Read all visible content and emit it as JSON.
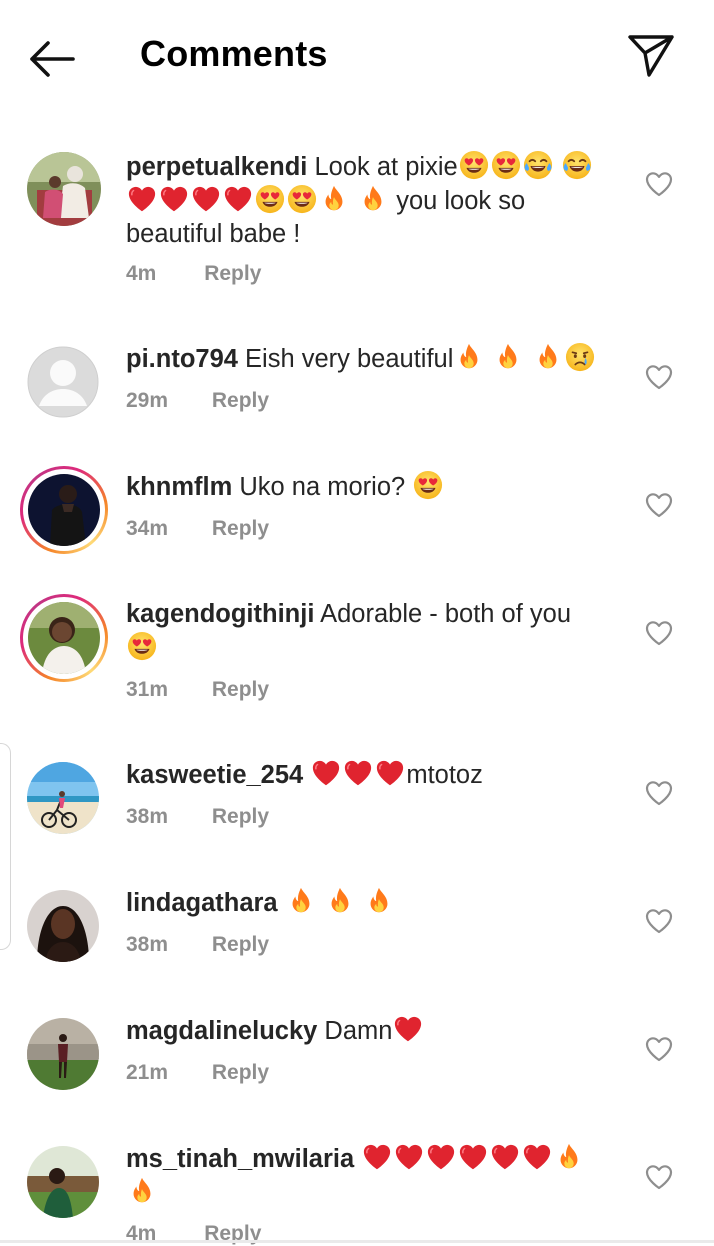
{
  "header": {
    "title": "Comments",
    "back_icon": "arrow-left-icon",
    "send_icon": "paper-plane-icon"
  },
  "comments": [
    {
      "username": "perpetualkendi",
      "text": "Look at pixie",
      "text_after": "you look so beautiful babe !",
      "emojis_a": [
        "heart-eyes",
        "heart-eyes",
        "joy",
        "joy"
      ],
      "emojis_b": [
        "red-heart",
        "red-heart",
        "red-heart",
        "red-heart",
        "heart-eyes",
        "heart-eyes",
        "fire",
        "fire"
      ],
      "time": "4m",
      "reply": "Reply"
    },
    {
      "username": "pi.nto794",
      "text": "Eish very beautiful",
      "emojis": [
        "fire",
        "fire",
        "fire",
        "crying"
      ],
      "time": "29m",
      "reply": "Reply"
    },
    {
      "username": "khnmflm",
      "text": "Uko na morio?",
      "emojis": [
        "heart-eyes"
      ],
      "time": "34m",
      "reply": "Reply"
    },
    {
      "username": "kagendogithinji",
      "text": "Adorable - both of you",
      "emojis": [
        "heart-eyes"
      ],
      "time": "31m",
      "reply": "Reply"
    },
    {
      "username": "kasweetie_254",
      "text": "mtotoz",
      "emojis": [
        "red-heart",
        "red-heart",
        "red-heart"
      ],
      "time": "38m",
      "reply": "Reply"
    },
    {
      "username": "lindagathara",
      "text": "",
      "emojis": [
        "fire",
        "fire",
        "fire"
      ],
      "time": "38m",
      "reply": "Reply"
    },
    {
      "username": "magdalinelucky",
      "text": "Damn",
      "emojis": [
        "red-heart"
      ],
      "time": "21m",
      "reply": "Reply"
    },
    {
      "username": "ms_tinah_mwilaria",
      "text": "",
      "emojis": [
        "red-heart",
        "red-heart",
        "red-heart",
        "red-heart",
        "red-heart",
        "red-heart",
        "fire",
        "fire"
      ],
      "time": "4m",
      "reply": "Reply"
    }
  ],
  "colors": {
    "text": "#262626",
    "meta": "#8e8e8e",
    "heart": "#e0242f",
    "story_ring_start": "#f58529",
    "story_ring_end": "#dd2a7b"
  }
}
